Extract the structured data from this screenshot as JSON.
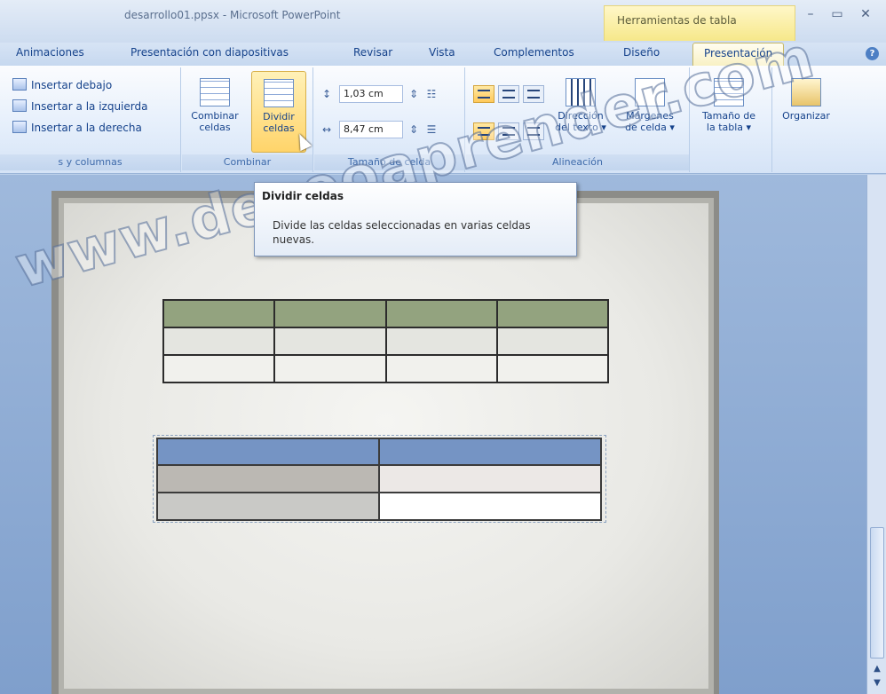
{
  "window": {
    "title": "desarrollo01.ppsx - Microsoft PowerPoint",
    "contextual_tools": "Herramientas de tabla"
  },
  "controls": {
    "minimize": "–",
    "restore": "▭",
    "close": "✕"
  },
  "tabs": [
    "Animaciones",
    "Presentación con diapositivas",
    "Revisar",
    "Vista",
    "Complementos",
    "Diseño",
    "Presentación"
  ],
  "active_tab": "Presentación",
  "ribbon": {
    "rows_columns": {
      "insert_below": "Insertar debajo",
      "insert_left": "Insertar a la izquierda",
      "insert_right": "Insertar a la derecha",
      "label": "s y columnas"
    },
    "merge": {
      "merge_cells": "Combinar celdas",
      "split_cells": "Dividir celdas",
      "label": "Combinar"
    },
    "cell_size": {
      "height": "1,03 cm",
      "width": "8,47 cm",
      "label": "Tamaño de celda"
    },
    "alignment": {
      "text_direction": "Dirección del texto ▾",
      "cell_margins": "Márgenes de celda ▾",
      "label": "Alineación"
    },
    "table_size": {
      "label": "Tamaño de la tabla ▾"
    },
    "arrange": {
      "label": "Organizar"
    }
  },
  "tooltip": {
    "title": "Dividir celdas",
    "body": "Divide las celdas seleccionadas en varias celdas nuevas."
  },
  "watermark": "www.deseoaprender.com",
  "colors": {
    "table1_header": "#93a37f",
    "table1_row": "#e4e5e0",
    "table1_row2": "#f1f1ed",
    "table2_header": "#7594c4",
    "table2_left": "#bbb8b3",
    "table2_left2": "#c9c9c6",
    "table2_right": "#ece8e6",
    "table2_right2": "#ffffff"
  }
}
